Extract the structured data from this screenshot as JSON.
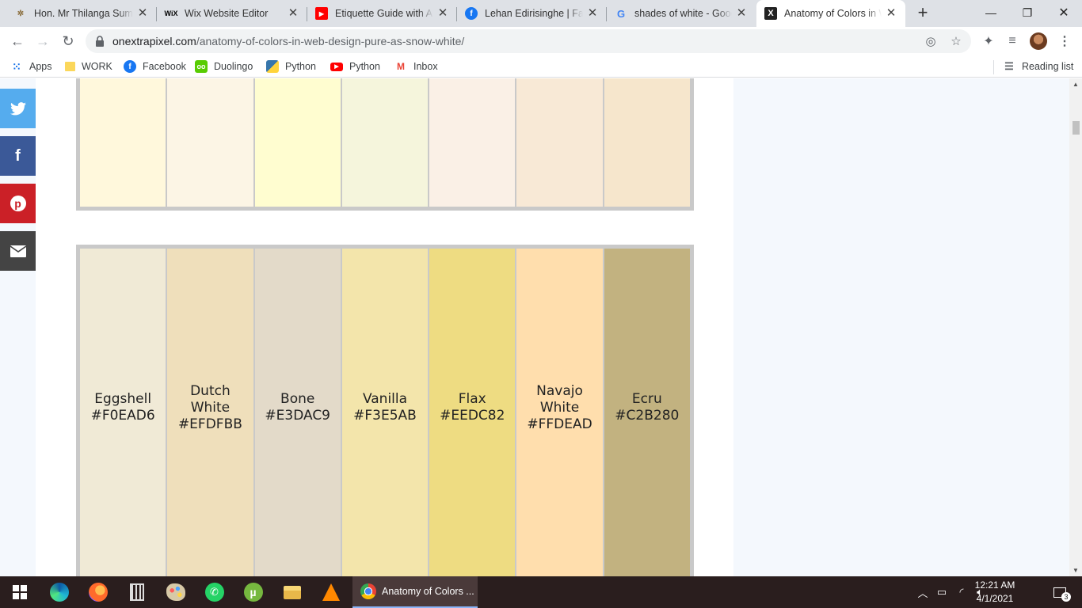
{
  "browser": {
    "tabs": [
      {
        "title": "Hon. Mr Thilanga Sumathipala",
        "favicon": "cricket-icon",
        "favicon_color": "#8a6d3b",
        "active": false
      },
      {
        "title": "Wix Website Editor",
        "favicon": "wix-icon",
        "favicon_color": "#000000",
        "active": false
      },
      {
        "title": "Etiquette Guide with Anna",
        "favicon": "youtube-icon",
        "favicon_color": "#ff0000",
        "active": false
      },
      {
        "title": "Lehan Edirisinghe | Facebook",
        "favicon": "facebook-icon",
        "favicon_color": "#1877f2",
        "active": false
      },
      {
        "title": "shades of white - Google Search",
        "favicon": "google-icon",
        "favicon_color": "#4285f4",
        "active": false
      },
      {
        "title": "Anatomy of Colors in Web Design",
        "favicon": "onextrapixel-icon",
        "favicon_color": "#222222",
        "active": true
      }
    ],
    "url": {
      "host": "onextrapixel.com",
      "path": "/anatomy-of-colors-in-web-design-pure-as-snow-white/"
    },
    "bookmarks": [
      {
        "label": "Apps",
        "icon": "apps-grid-icon"
      },
      {
        "label": "WORK",
        "icon": "folder-icon"
      },
      {
        "label": "Facebook",
        "icon": "facebook-icon"
      },
      {
        "label": "Duolingo",
        "icon": "duolingo-icon"
      },
      {
        "label": "Python",
        "icon": "python-icon"
      },
      {
        "label": "Python",
        "icon": "youtube-icon"
      },
      {
        "label": "Inbox",
        "icon": "gmail-icon"
      }
    ],
    "reading_list": "Reading list"
  },
  "share_buttons": [
    {
      "name": "twitter",
      "icon": "twitter-icon",
      "color": "#55acee"
    },
    {
      "name": "facebook",
      "icon": "facebook-icon",
      "color": "#3b5998"
    },
    {
      "name": "pinterest",
      "icon": "pinterest-icon",
      "color": "#cb2027"
    },
    {
      "name": "email",
      "icon": "email-icon",
      "color": "#444444"
    }
  ],
  "palette_top": {
    "colors": [
      "#FFF8DC",
      "#FCF5E5",
      "#FFFDD0",
      "#F5F5DC",
      "#FAF0E6",
      "#F8E9D6",
      "#F6E6CC"
    ]
  },
  "palette_bottom": {
    "swatches": [
      {
        "name": "Eggshell",
        "hex": "#F0EAD6"
      },
      {
        "name": "Dutch White",
        "hex": "#EFDFBB"
      },
      {
        "name": "Bone",
        "hex": "#E3DAC9"
      },
      {
        "name": "Vanilla",
        "hex": "#F3E5AB"
      },
      {
        "name": "Flax",
        "hex": "#EEDC82"
      },
      {
        "name": "Navajo White",
        "hex": "#FFDEAD"
      },
      {
        "name": "Ecru",
        "hex": "#C2B280"
      }
    ]
  },
  "taskbar": {
    "active_window": "Anatomy of Colors ...",
    "apps": [
      "edge-icon",
      "firefox-icon",
      "calculator-icon",
      "paint-icon",
      "whatsapp-icon",
      "utorrent-icon",
      "file-explorer-icon",
      "vlc-icon"
    ],
    "time": "12:21 AM",
    "date": "4/1/2021",
    "notifications": "3"
  }
}
